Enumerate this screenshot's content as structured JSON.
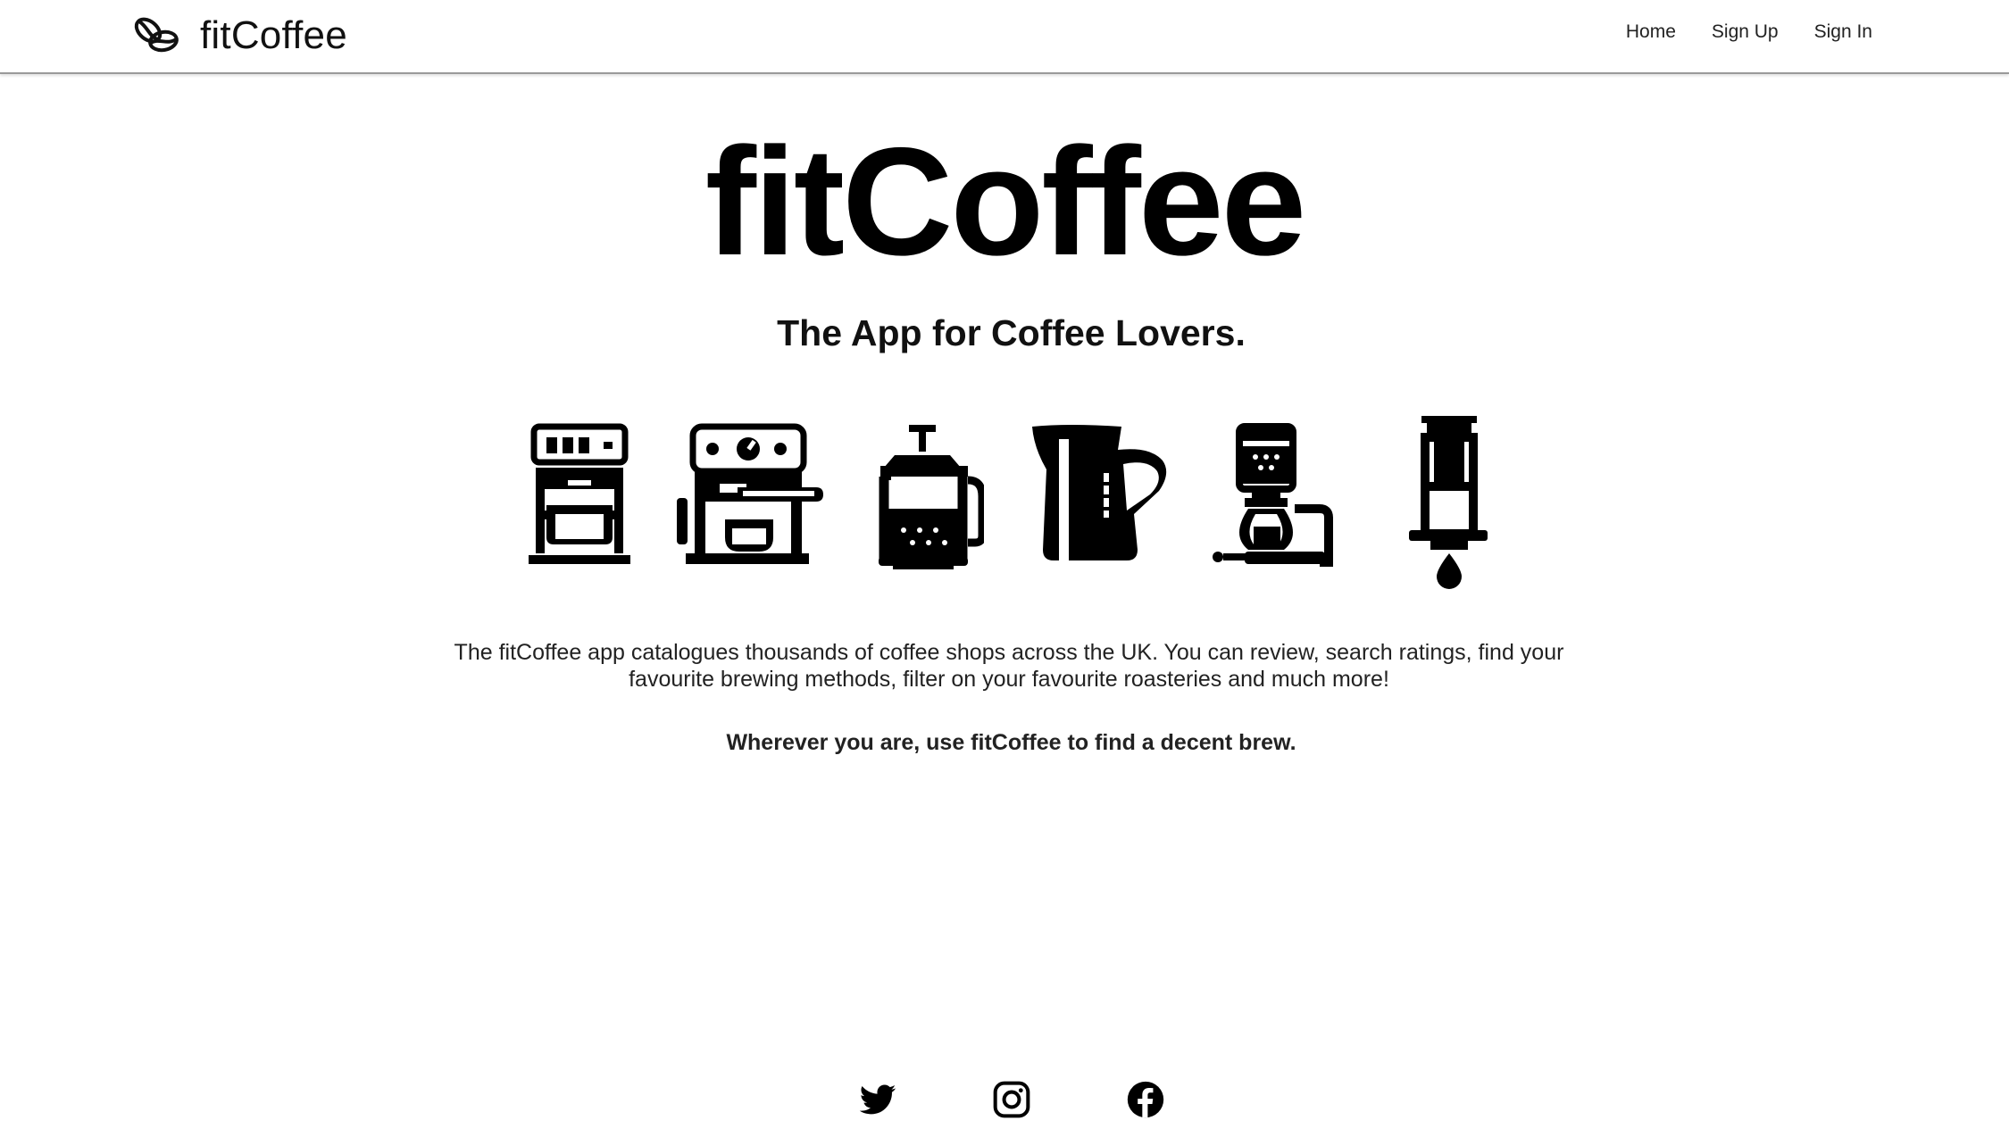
{
  "navbar": {
    "brand_name": "fitCoffee",
    "brand_icon": "coffee-beans-icon",
    "links": [
      {
        "label": "Home"
      },
      {
        "label": "Sign Up"
      },
      {
        "label": "Sign In"
      }
    ]
  },
  "hero": {
    "title": "fitCoffee",
    "subtitle": "The App for Coffee Lovers."
  },
  "brewing_icons": [
    "drip-coffee-machine-icon",
    "espresso-machine-icon",
    "french-press-icon",
    "milk-jug-icon",
    "siphon-coffee-maker-icon",
    "aeropress-icon"
  ],
  "content": {
    "description": "The fitCoffee app catalogues thousands of coffee shops across the UK. You can review, search ratings, find your favourite brewing methods, filter on your favourite roasteries and much more!",
    "tagline": "Wherever you are, use fitCoffee to find a decent brew."
  },
  "social": [
    "twitter-icon",
    "instagram-icon",
    "facebook-icon"
  ],
  "colors": {
    "text": "#111111",
    "icon": "#000000",
    "background": "#ffffff",
    "nav_border": "#9a9a9a"
  }
}
